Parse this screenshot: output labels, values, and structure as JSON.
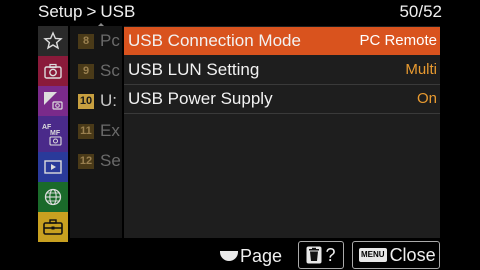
{
  "header": {
    "breadcrumb_parent": "Setup",
    "breadcrumb_sep": ">",
    "breadcrumb_current": "USB",
    "page_counter": "50/52"
  },
  "categories": [
    {
      "icon": "star-icon",
      "color": "#2a2a2a"
    },
    {
      "icon": "camera-icon",
      "color": "#8a1a3a"
    },
    {
      "icon": "photo-adjust-icon",
      "color": "#7a2a8a"
    },
    {
      "icon": "af-mf-icon",
      "color": "#4a2a8a"
    },
    {
      "icon": "playback-icon",
      "color": "#2a3a9a"
    },
    {
      "icon": "network-icon",
      "color": "#1a6a2a"
    },
    {
      "icon": "setup-toolbox-icon",
      "color": "#c8a020"
    }
  ],
  "pages": [
    {
      "num": "8",
      "label": "Pc",
      "active": false
    },
    {
      "num": "9",
      "label": "Sc",
      "active": false
    },
    {
      "num": "10",
      "label": "U:",
      "active": true
    },
    {
      "num": "11",
      "label": "Ex",
      "active": false
    },
    {
      "num": "12",
      "label": "Se",
      "active": false
    }
  ],
  "menu": [
    {
      "name": "USB Connection Mode",
      "value": "PC Remote",
      "selected": true
    },
    {
      "name": "USB LUN Setting",
      "value": "Multi",
      "selected": false
    },
    {
      "name": "USB Power Supply",
      "value": "On",
      "selected": false
    }
  ],
  "bottom": {
    "page_label": "Page",
    "delete_help": "?",
    "menu_badge": "MENU",
    "close_label": "Close"
  },
  "colors": {
    "selection": "#d9531e",
    "value_text": "#e89a30",
    "active_page": "#c8a040"
  }
}
